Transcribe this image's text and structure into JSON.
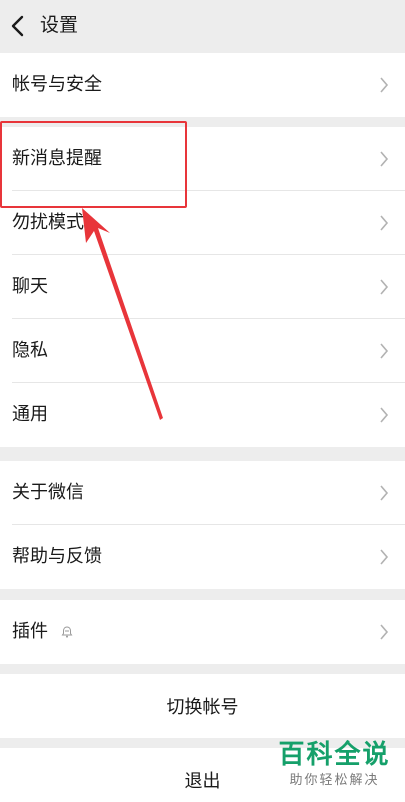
{
  "header": {
    "title": "设置",
    "back_icon": "chevron-left-icon"
  },
  "groups": {
    "account": {
      "label": "帐号与安全"
    },
    "main": {
      "items": [
        {
          "label": "新消息提醒"
        },
        {
          "label": "勿扰模式"
        },
        {
          "label": "聊天"
        },
        {
          "label": "隐私"
        },
        {
          "label": "通用"
        }
      ]
    },
    "about": {
      "items": [
        {
          "label": "关于微信"
        },
        {
          "label": "帮助与反馈"
        }
      ]
    },
    "plugins": {
      "label": "插件",
      "badge_icon": "bell-badge-icon"
    }
  },
  "actions": {
    "switch_account": "切换帐号",
    "logout": "退出"
  },
  "annotation": {
    "color": "#e8353a"
  },
  "watermark": {
    "main": "百科全说",
    "sub": "助你轻松解决"
  },
  "colors": {
    "background": "#ededed",
    "card": "#ffffff",
    "chevron": "#b2b2b2",
    "watermark": "#15a06a"
  }
}
